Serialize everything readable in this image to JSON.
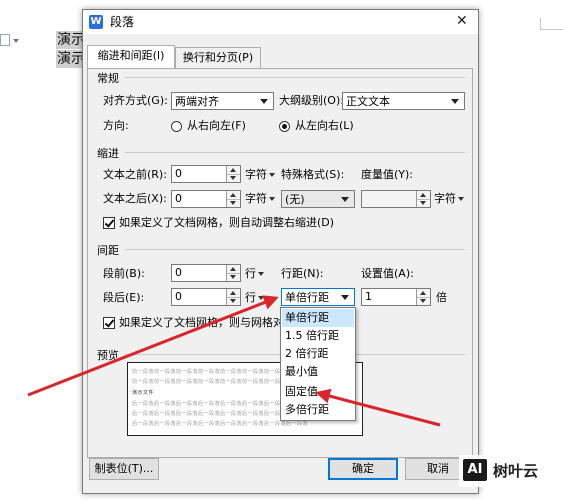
{
  "document": {
    "lines": [
      "演示文",
      "演示文"
    ]
  },
  "dialog": {
    "title": "段落",
    "close_label": "✕",
    "tabs": [
      {
        "label": "缩进和间距(I)",
        "active": true
      },
      {
        "label": "换行和分页(P)",
        "active": false
      }
    ],
    "general": {
      "section_title": "常规",
      "alignment_label": "对齐方式(G):",
      "alignment_value": "两端对齐",
      "outline_label": "大纲级别(O):",
      "outline_value": "正文文本",
      "direction_label": "方向:",
      "direction_rtl_label": "从右向左(F)",
      "direction_ltr_label": "从左向右(L)",
      "direction_selected": "ltr"
    },
    "indent": {
      "section_title": "缩进",
      "before_label": "文本之前(R):",
      "before_value": "0",
      "before_unit": "字符",
      "after_label": "文本之后(X):",
      "after_value": "0",
      "after_unit": "字符",
      "special_label": "特殊格式(S):",
      "special_value": "(无)",
      "measure_label": "度量值(Y):",
      "measure_value": "",
      "measure_unit": "字符",
      "grid_checkbox_label": "如果定义了文档网格，则自动调整右缩进(D)",
      "grid_checked": true
    },
    "spacing": {
      "section_title": "间距",
      "before_label": "段前(B):",
      "before_value": "0",
      "before_unit": "行",
      "after_label": "段后(E):",
      "after_value": "0",
      "after_unit": "行",
      "line_label": "行距(N):",
      "line_value": "单倍行距",
      "setting_label": "设置值(A):",
      "setting_value": "1",
      "setting_unit": "倍",
      "grid_checkbox_label": "如果定义了文档网格，则与网格对",
      "grid_checked": true,
      "line_options": [
        "单倍行距",
        "1.5 倍行距",
        "2 倍行距",
        "最小值",
        "固定值",
        "多倍行距"
      ],
      "line_selected_index": 0
    },
    "preview": {
      "section_title": "预览",
      "prev_text": "前一段落前一段落前一段落前一段落前一段落前一段落前一段落前一段落",
      "sample_text": "演示文件",
      "next_text": "后一段落后一段落后一段落后一段落后一段落后一段落后一段落后一段落"
    },
    "buttons": {
      "tabs_label": "制表位(T)...",
      "ok_label": "确定",
      "cancel_label": "取消"
    }
  },
  "watermark": {
    "logo_text": "AI",
    "brand_text": "树叶云"
  },
  "colors": {
    "arrow": "#d9262b",
    "selection": "#cce8ff",
    "primary_border": "#0078d7"
  }
}
